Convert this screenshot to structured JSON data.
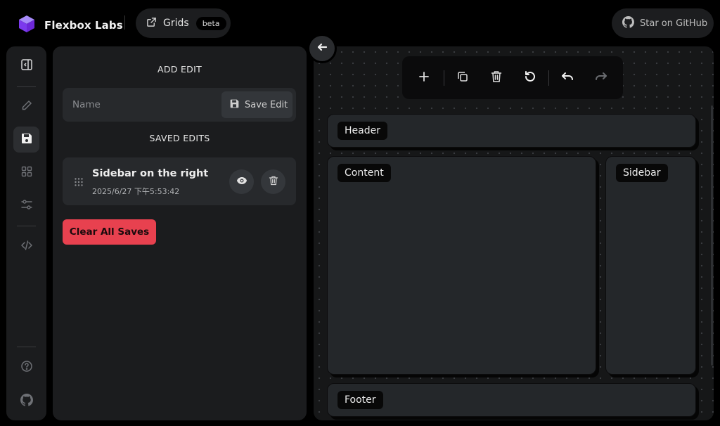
{
  "app": {
    "brand_name": "Flexbox Labs",
    "nav_link_label": "Grids",
    "nav_badge": "beta",
    "github_label": "Star on GitHub",
    "accent_color": "#8b5cf6"
  },
  "rail": {
    "items": [
      {
        "name": "collapse-panel",
        "icon": "sidebar-toggle-icon"
      },
      {
        "name": "edit",
        "icon": "pencil-icon"
      },
      {
        "name": "saved-edits",
        "icon": "save-icon",
        "active": true
      },
      {
        "name": "templates",
        "icon": "grid-icon"
      },
      {
        "name": "settings",
        "icon": "sliders-icon"
      },
      {
        "name": "code",
        "icon": "code-icon"
      },
      {
        "name": "help",
        "icon": "help-circle-icon"
      },
      {
        "name": "github",
        "icon": "github-icon"
      }
    ]
  },
  "panel": {
    "add_edit_title": "ADD EDIT",
    "name_placeholder": "Name",
    "name_value": "",
    "save_edit_label": "Save Edit",
    "saved_edits_title": "SAVED EDITS",
    "saved_edits": [
      {
        "title": "Sidebar on the right",
        "timestamp": "2025/6/27 下午5:53:42"
      }
    ],
    "clear_all_label": "Clear All Saves",
    "danger_color": "#e8414f"
  },
  "toolbar": {
    "tools": [
      "add-icon",
      "copy-icon",
      "trash-icon",
      "reset-icon",
      "undo-icon",
      "redo-icon"
    ]
  },
  "layout_blocks": {
    "header": "Header",
    "content": "Content",
    "sidebar": "Sidebar",
    "footer": "Footer"
  }
}
